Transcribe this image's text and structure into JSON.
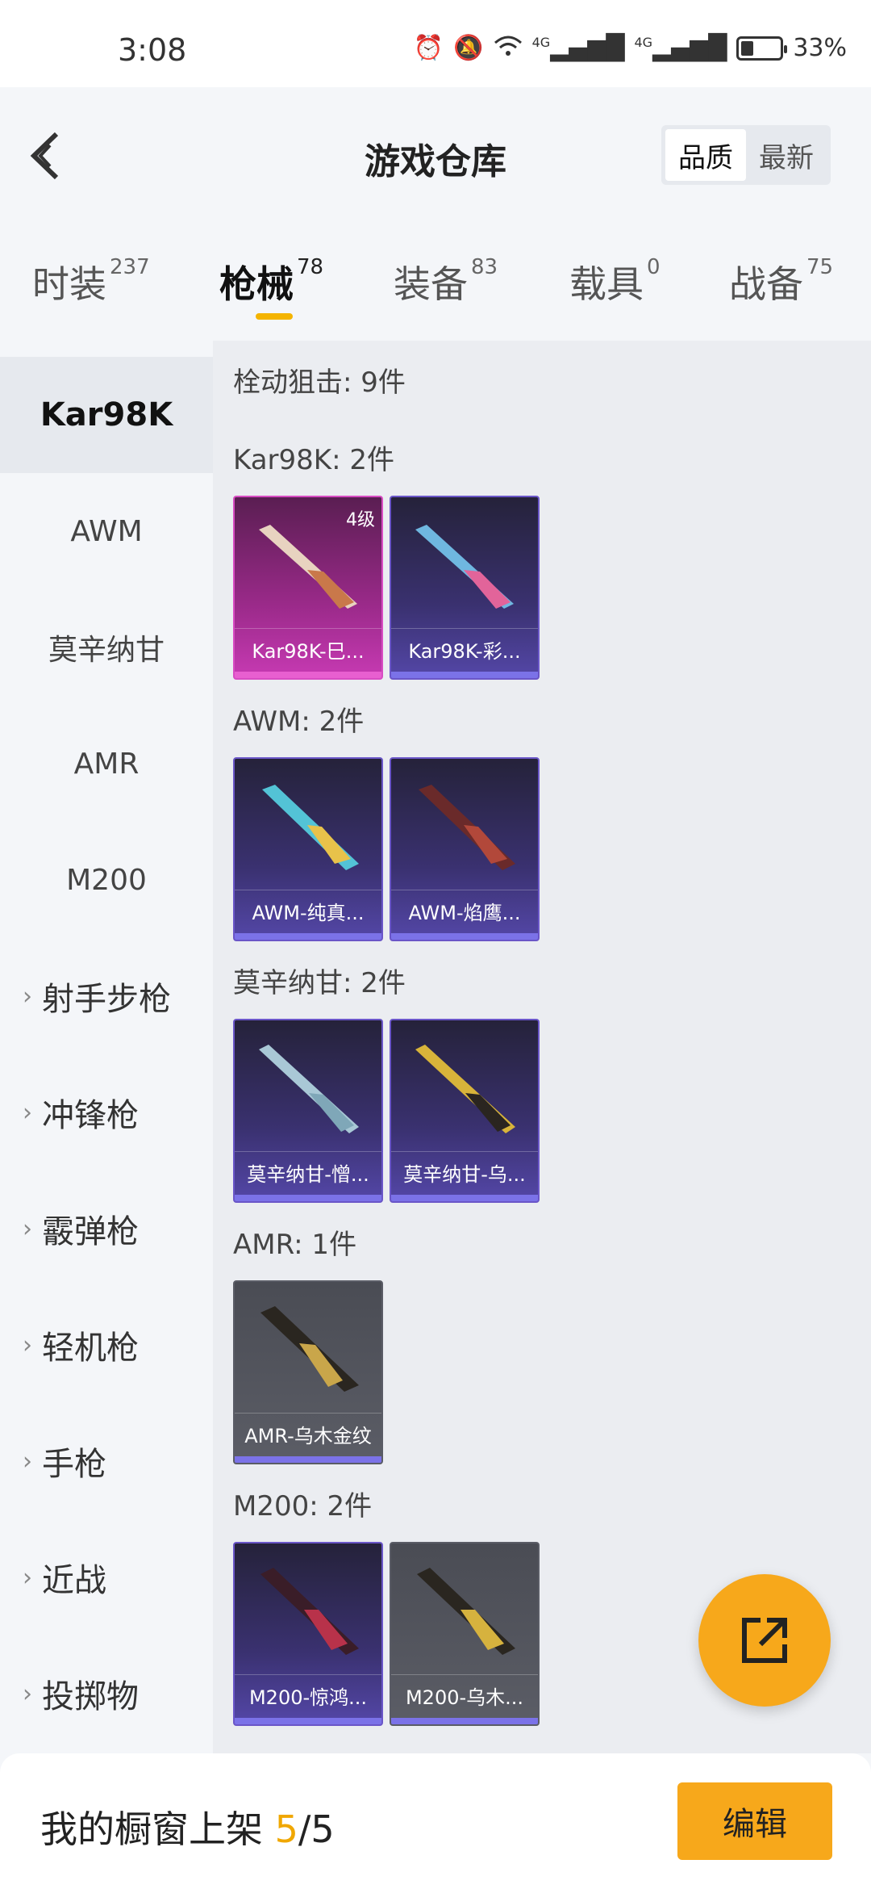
{
  "status": {
    "time": "3:08",
    "net1": "4G",
    "net2": "4G",
    "battery": "33%",
    "battery_level": 0.33
  },
  "header": {
    "title": "游戏仓库",
    "sort_quality": "品质",
    "sort_latest": "最新"
  },
  "tabs": [
    {
      "label": "时装",
      "count": "237"
    },
    {
      "label": "枪械",
      "count": "78"
    },
    {
      "label": "装备",
      "count": "83"
    },
    {
      "label": "载具",
      "count": "0"
    },
    {
      "label": "战备",
      "count": "75"
    }
  ],
  "sidebar": [
    "Kar98K",
    "AWM",
    "莫辛纳甘",
    "AMR",
    "M200",
    "射手步枪",
    "冲锋枪",
    "霰弹枪",
    "轻机枪",
    "手枪",
    "近战",
    "投掷物"
  ],
  "content": {
    "summary": "栓动狙击: 9件",
    "sections": [
      {
        "label": "Kar98K: 2件",
        "items": [
          {
            "name": "Kar98K-巳...",
            "badge": "4级"
          },
          {
            "name": "Kar98K-彩..."
          }
        ]
      },
      {
        "label": "AWM: 2件",
        "items": [
          {
            "name": "AWM-纯真..."
          },
          {
            "name": "AWM-焰鹰..."
          }
        ]
      },
      {
        "label": "莫辛纳甘: 2件",
        "items": [
          {
            "name": "莫辛纳甘-憎..."
          },
          {
            "name": "莫辛纳甘-乌..."
          }
        ]
      },
      {
        "label": "AMR: 1件",
        "items": [
          {
            "name": "AMR-乌木金纹"
          }
        ]
      },
      {
        "label": "M200: 2件",
        "items": [
          {
            "name": "M200-惊鸿..."
          },
          {
            "name": "M200-乌木..."
          }
        ]
      }
    ]
  },
  "bottom": {
    "label": "我的橱窗上架",
    "current": "5",
    "total": "/5",
    "edit": "编辑"
  },
  "icons": {
    "back": "chevron-left-icon",
    "fab": "share-external-icon",
    "accent": "#f7a81b"
  }
}
